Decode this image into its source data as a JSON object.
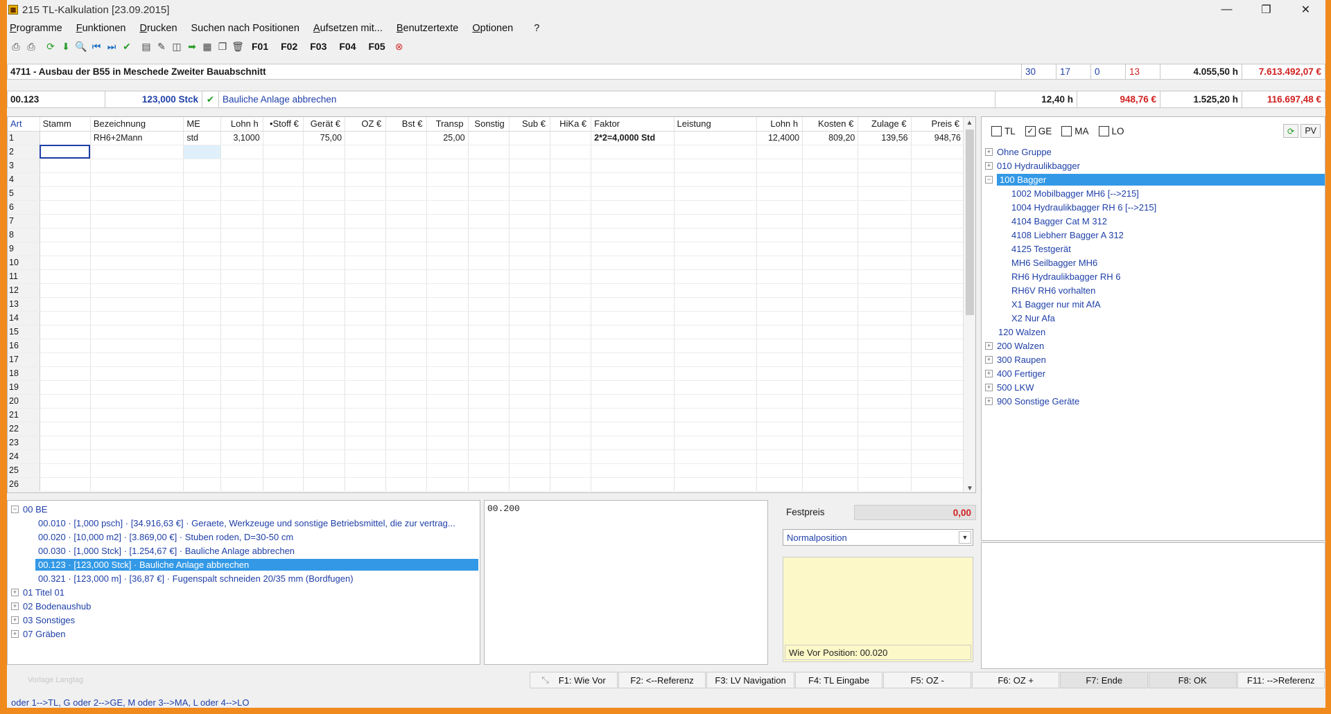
{
  "window": {
    "title": "215 TL-Kalkulation [23.09.2015]",
    "icon": "calc-app-icon"
  },
  "menu": [
    {
      "label": "Programme",
      "u": "P"
    },
    {
      "label": "Funktionen",
      "u": "F"
    },
    {
      "label": "Drucken",
      "u": "D"
    },
    {
      "label": "Suchen nach Positionen",
      "u": ""
    },
    {
      "label": "Aufsetzen mit...",
      "u": "A"
    },
    {
      "label": "Benutzertexte",
      "u": "B"
    },
    {
      "label": "Optionen",
      "u": "O"
    },
    {
      "label": "?",
      "u": ""
    }
  ],
  "toolbar_fkeys": [
    "F01",
    "F02",
    "F03",
    "F04",
    "F05"
  ],
  "project": {
    "title": "4711 - Ausbau der B55 in Meschede Zweiter Bauabschnitt",
    "c1": "30",
    "c2": "17",
    "c3": "0",
    "c4": "13",
    "hours": "4.055,50 h",
    "total": "7.613.492,07 €"
  },
  "position": {
    "oz": "00.123",
    "qty": "123,000 Stck",
    "text": "Bauliche Anlage abbrechen",
    "hours": "12,40 h",
    "ep": "948,76 €",
    "totalhours": "1.525,20 h",
    "gp": "116.697,48 €"
  },
  "grid": {
    "headers": [
      "Art",
      "Stamm",
      "Bezeichnung",
      "ME",
      "Lohn h",
      "•Stoff €",
      "Gerät €",
      "OZ €",
      "Bst €",
      "Transp",
      "Sonstig",
      "Sub €",
      "HiKa €",
      "Faktor",
      "Leistung",
      "Lohn h",
      "Kosten €",
      "Zulage €",
      "Preis €"
    ],
    "row1": {
      "bez": "RH6+2Mann",
      "me": "std",
      "lohn": "3,1000",
      "geraet": "75,00",
      "transp": "25,00",
      "faktor": "2*2=4,0000 Std",
      "lohn2": "12,4000",
      "kosten": "809,20",
      "zulage": "139,56",
      "preis": "948,76"
    },
    "row_numbers": [
      "1",
      "2",
      "3",
      "4",
      "5",
      "6",
      "7",
      "8",
      "9",
      "10",
      "11",
      "12",
      "13",
      "14",
      "15",
      "16",
      "17",
      "18",
      "19",
      "20",
      "21",
      "22",
      "23",
      "24",
      "25",
      "26"
    ]
  },
  "filters": {
    "tl": "TL",
    "ge": "GE",
    "ma": "MA",
    "lo": "LO",
    "pv": "PV"
  },
  "device_tree": {
    "top": [
      "Ohne Gruppe",
      "010 Hydraulikbagger"
    ],
    "selected": "100 Bagger",
    "children": [
      "1002 Mobilbagger MH6 [-->215]",
      "1004 Hydraulikbagger RH 6 [-->215]",
      "4104 Bagger Cat M 312",
      "4108 Liebherr Bagger A 312",
      "4125 Testgerät",
      "MH6 Seilbagger MH6",
      "RH6 Hydraulikbagger RH 6",
      "RH6V RH6 vorhalten",
      "X1 Bagger nur mit AfA",
      "X2 Nur Afa"
    ],
    "leaf_after": "120 Walzen",
    "bottom": [
      "200 Walzen",
      "300 Raupen",
      "400 Fertiger",
      "500 LKW",
      "900 Sonstige Geräte"
    ]
  },
  "lv_tree": {
    "root": "00 BE",
    "items": [
      "00.010 · [1,000 psch] · [34.916,63 €] · Geraete, Werkzeuge und sonstige Betriebsmittel, die zur vertrag...",
      "00.020 · [10,000 m2] · [3.869,00 €] · Stuben roden, D=30-50 cm",
      "00.030 · [1,000 Stck] · [1.254,67 €] · Bauliche Anlage abbrechen",
      "00.123 · [123,000 Stck] · Bauliche Anlage abbrechen",
      "00.321 · [123,000 m] · [36,87 €] · Fugenspalt schneiden 20/35 mm (Bordfugen)"
    ],
    "groups": [
      "01 Titel 01",
      "02 Bodenaushub",
      "03 Sonstiges",
      "07 Gräben"
    ]
  },
  "memo": {
    "text": "00.200"
  },
  "festpreis": {
    "label": "Festpreis",
    "value": "0,00",
    "position_type": "Normalposition",
    "note_footer": "Wie Vor Position: 00.020"
  },
  "fbar": {
    "placeholder": "Vorlage Langtag",
    "buttons": [
      "F1: Wie Vor",
      "F2: <--Referenz",
      "F3: LV Navigation",
      "F4: TL Eingabe",
      "F5: OZ -",
      "F6: OZ +",
      "F7: Ende",
      "F8: OK",
      "F11: -->Referenz"
    ]
  },
  "status": {
    "text": "oder 1-->TL, G oder 2-->GE, M oder 3-->MA, L oder 4-->LO"
  }
}
